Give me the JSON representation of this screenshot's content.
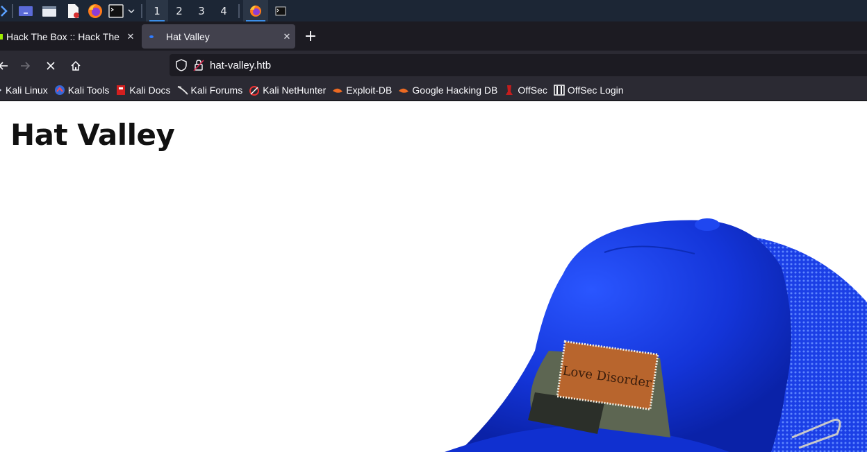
{
  "desktop_panel": {
    "workspaces": [
      "1",
      "2",
      "3",
      "4"
    ],
    "active_workspace": "1",
    "launchers": [
      "kali-menu-icon",
      "desktop-icon",
      "file-manager-icon",
      "text-editor-icon",
      "firefox-icon",
      "terminal-icon",
      "chevron-down-icon"
    ],
    "tasks": [
      "firefox-icon",
      "terminal-icon"
    ]
  },
  "browser": {
    "tabs": [
      {
        "title": "Hack The Box :: Hack The Box",
        "active": false
      },
      {
        "title": "Hat Valley",
        "active": true
      }
    ],
    "url": "hat-valley.htb",
    "bookmarks": [
      {
        "label": "Kali Linux",
        "icon": "kali-icon"
      },
      {
        "label": "Kali Tools",
        "icon": "kali-tools-icon"
      },
      {
        "label": "Kali Docs",
        "icon": "kali-docs-icon"
      },
      {
        "label": "Kali Forums",
        "icon": "kali-forums-icon"
      },
      {
        "label": "Kali NetHunter",
        "icon": "nethunter-icon"
      },
      {
        "label": "Exploit-DB",
        "icon": "exploit-db-icon"
      },
      {
        "label": "Google Hacking DB",
        "icon": "ghdb-icon"
      },
      {
        "label": "OffSec",
        "icon": "offsec-icon"
      },
      {
        "label": "OffSec Login",
        "icon": "offsec-login-icon"
      }
    ]
  },
  "page": {
    "heading": "Hat Valley",
    "hat_patch_text": "Love Disorder"
  },
  "colors": {
    "panel_bg": "#1c2635",
    "tabstrip_bg": "#1c1b22",
    "toolbar_bg": "#2b2a33",
    "active_tab_bg": "#42414d",
    "accent": "#3b8ee8",
    "hat_blue": "#1a3fe0"
  }
}
